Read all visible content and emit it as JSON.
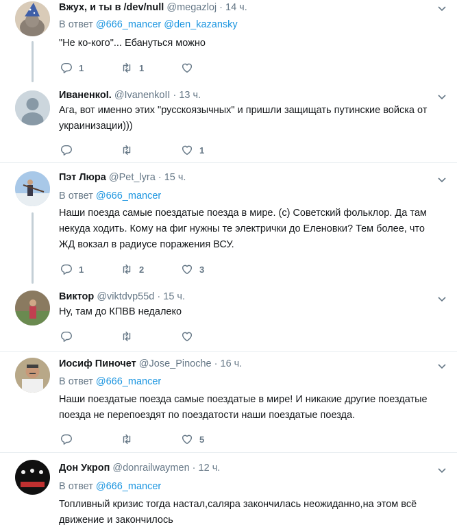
{
  "tweets": [
    {
      "name": "Вжух, и ты в /dev/null",
      "handle": "@megazloj",
      "time": "14 ч.",
      "reply_label": "В ответ",
      "reply_to": [
        "@666_mancer",
        "@den_kazansky"
      ],
      "text": "\"Не ко-кого\"... Ебануться можно",
      "replies": "1",
      "retweets": "1",
      "likes": ""
    },
    {
      "name": "ИваненкоI.",
      "handle": "@IvanenkoII",
      "time": "13 ч.",
      "text": "Ага, вот именно этих \"русскоязычных\" и пришли защищать путинские войска от украинизации)))",
      "replies": "",
      "retweets": "",
      "likes": "1"
    },
    {
      "name": "Пэт Люра",
      "handle": "@Pet_lyra",
      "time": "15 ч.",
      "reply_label": "В ответ",
      "reply_to": [
        "@666_mancer"
      ],
      "text": "Наши поезда самые поездатые поезда в мире. (с) Советский фольклор. Да там некуда ходить. Кому на фиг нужны те электрички до Еленовки? Тем более, что ЖД вокзал в радиусе поражения ВСУ.",
      "replies": "1",
      "retweets": "2",
      "likes": "3"
    },
    {
      "name": "Виктор",
      "handle": "@viktdvp55d",
      "time": "15 ч.",
      "text": "Ну, там до КПВВ недалеко",
      "replies": "",
      "retweets": "",
      "likes": ""
    },
    {
      "name": "Иосиф Пиночет",
      "handle": "@Jose_Pinoche",
      "time": "16 ч.",
      "reply_label": "В ответ",
      "reply_to": [
        "@666_mancer"
      ],
      "text": "Наши поездатые поезда самые поездатые в мире! И никакие другие поездатые поезда не перепоездят по поездатости наши поездатые поезда.",
      "replies": "",
      "retweets": "",
      "likes": "5"
    },
    {
      "name": "Дон Укроп",
      "handle": "@donrailwaymen",
      "time": "12 ч.",
      "reply_label": "В ответ",
      "reply_to": [
        "@666_mancer"
      ],
      "text": "Топливный кризис тогда настал,саляра закончилась неожиданно,на этом всё движение и закончилось"
    }
  ],
  "dot": "·",
  "icons": {
    "reply": "reply-icon",
    "retweet": "retweet-icon",
    "like": "heart-icon",
    "menu": "chevron-down-icon"
  },
  "colors": {
    "link": "#1b95e0",
    "muted": "#657786",
    "thread": "#c4cfd6",
    "divider": "#e6ecf0"
  }
}
